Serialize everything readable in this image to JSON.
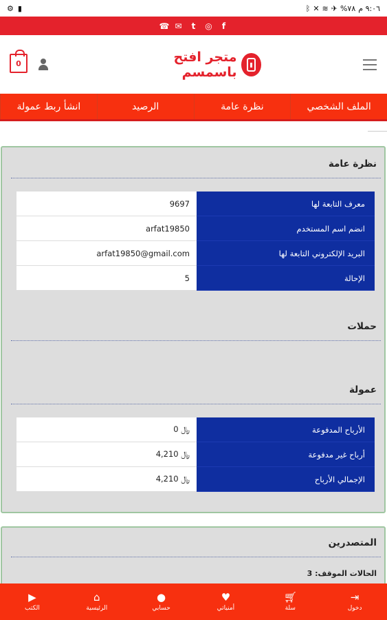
{
  "status_bar": {
    "time": "٩:٠٦ م",
    "battery": "٧٨%"
  },
  "header": {
    "cart_count": "0",
    "logo_text": "متجر افتح باسمسم"
  },
  "tabs": [
    {
      "label": "الملف الشخصي"
    },
    {
      "label": "نظرة عامة"
    },
    {
      "label": "الرصيد"
    },
    {
      "label": "انشأ ربط عمولة"
    }
  ],
  "overview": {
    "title": "نظرة عامة",
    "rows": [
      {
        "key": "معرف التابعة لها",
        "value": "9697"
      },
      {
        "key": "انضم اسم المستخدم",
        "value": "arfat19850"
      },
      {
        "key": "البريد الإلكتروني التابعة لها",
        "value": "arfat19850@gmail.com"
      },
      {
        "key": "الإحالة",
        "value": "5"
      }
    ]
  },
  "campaigns": {
    "title": "حملات"
  },
  "commission": {
    "title": "عمولة",
    "rows": [
      {
        "key": "الأرباح المدفوعة",
        "value": "0 ﷼"
      },
      {
        "key": "أرباح غير مدفوعة",
        "value": "4,210 ﷼"
      },
      {
        "key": "الإجمالي الأرباح",
        "value": "4,210 ﷼"
      }
    ]
  },
  "referrers": {
    "title": "المتصدرين",
    "stopped_label": "الحالات الموقف:",
    "stopped_value": "3"
  },
  "bottom_nav": [
    {
      "label": "دخول",
      "icon": "login-icon"
    },
    {
      "label": "سلة",
      "icon": "cart-icon"
    },
    {
      "label": "أمنياتي",
      "icon": "heart-icon"
    },
    {
      "label": "حسابي",
      "icon": "user-icon"
    },
    {
      "label": "الرئيسية",
      "icon": "home-icon"
    },
    {
      "label": "الكتب",
      "icon": "video-icon"
    }
  ],
  "colors": {
    "accent_red": "#e4222c",
    "tab_orange": "#f7300f",
    "table_key_blue": "#0f2ea0",
    "card_border_green": "#9fc6a1"
  }
}
